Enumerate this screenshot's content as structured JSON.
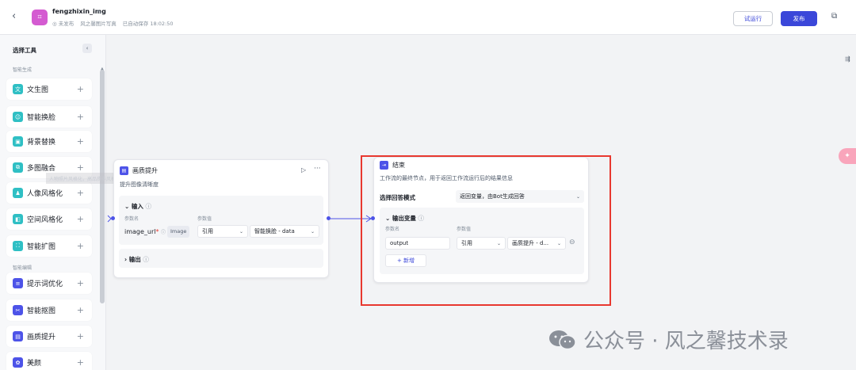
{
  "header": {
    "app_name": "fengzhixin_img",
    "status": "◎ 未发布",
    "subtitle": "风之馨图片写真",
    "autosave": "已自动保存 18:02:50",
    "test_run_label": "试运行",
    "publish_label": "发布"
  },
  "sidebar": {
    "title": "选择工具",
    "section_smart_gen": "智能生成",
    "section_smart_edit": "智能编辑",
    "tooltip": "人物照片风格化，高品质多风格",
    "items": [
      {
        "label": "文生图",
        "icon": "text-to-image-icon",
        "color": "#2fbfc4",
        "glyph": "文"
      },
      {
        "label": "智能换脸",
        "icon": "face-swap-icon",
        "color": "#2fbfc4",
        "glyph": "☺"
      },
      {
        "label": "背景替换",
        "icon": "background-replace-icon",
        "color": "#2fbfc4",
        "glyph": "▣"
      },
      {
        "label": "多图融合",
        "icon": "multi-image-merge-icon",
        "color": "#2fbfc4",
        "glyph": "⧉"
      },
      {
        "label": "人像风格化",
        "icon": "portrait-style-icon",
        "color": "#2fbfc4",
        "glyph": "♟"
      },
      {
        "label": "空间风格化",
        "icon": "space-style-icon",
        "color": "#2fbfc4",
        "glyph": "◧"
      },
      {
        "label": "智能扩图",
        "icon": "image-expand-icon",
        "color": "#2fbfc4",
        "glyph": "⛶"
      },
      {
        "label": "提示词优化",
        "icon": "prompt-optimize-icon",
        "color": "#4d53e8",
        "glyph": "≡"
      },
      {
        "label": "智能抠图",
        "icon": "smart-cutout-icon",
        "color": "#4d53e8",
        "glyph": "✂"
      },
      {
        "label": "画质提升",
        "icon": "quality-enhance-icon",
        "color": "#4d53e8",
        "glyph": "▤"
      },
      {
        "label": "美颜",
        "icon": "beautify-icon",
        "color": "#4d53e8",
        "glyph": "✿"
      }
    ]
  },
  "node_quality": {
    "title": "画质提升",
    "description": "提升图像清晰度",
    "input_label": "输入",
    "param_name_label": "参数名",
    "param_value_label": "参数值",
    "param_name": "image_url",
    "required_mark": "*",
    "type_badge": "Image",
    "ref_select": "引用",
    "value_select": "智能换脸 - data",
    "output_label": "输出"
  },
  "node_end": {
    "title": "结束",
    "description": "工作流的最终节点，用于返回工作流运行后的结果信息",
    "mode_label": "选择回答模式",
    "mode_value": "返回变量，由Bot生成回答",
    "output_vars_label": "输出变量",
    "param_name_label": "参数名",
    "param_value_label": "参数值",
    "param_name": "output",
    "ref_select": "引用",
    "value_select": "画质提升 - d...",
    "add_label": "+ 新增"
  },
  "watermark": {
    "text": "公众号 · 风之馨技术录"
  }
}
